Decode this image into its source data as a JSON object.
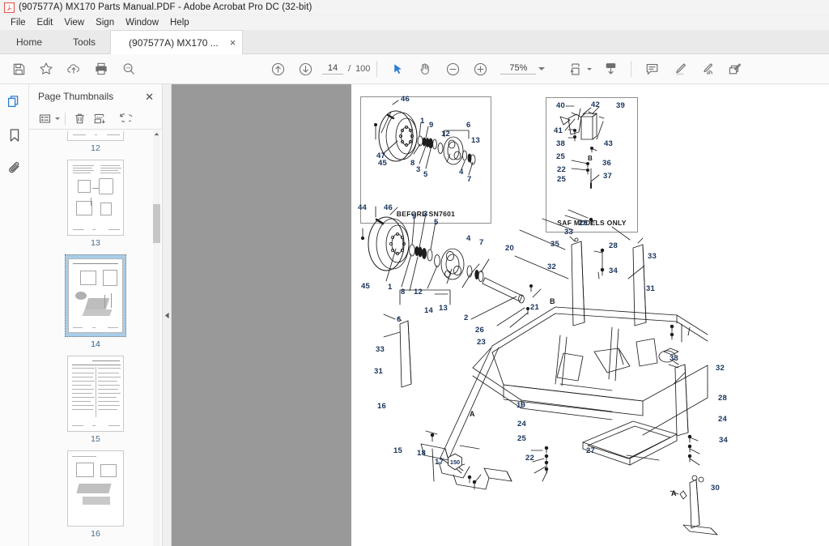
{
  "window": {
    "title": "(907577A) MX170 Parts Manual.PDF - Adobe Acrobat Pro DC (32-bit)",
    "app_icon": "acrobat-icon"
  },
  "menubar": {
    "items": [
      {
        "label": "File"
      },
      {
        "label": "Edit"
      },
      {
        "label": "View"
      },
      {
        "label": "Sign"
      },
      {
        "label": "Window"
      },
      {
        "label": "Help"
      }
    ]
  },
  "tabs": {
    "home_label": "Home",
    "tools_label": "Tools",
    "document_label": "(907577A) MX170 ...",
    "close_glyph": "×"
  },
  "toolbar": {
    "save_icon": "save-icon",
    "star_icon": "add-to-favorites-icon",
    "cloud_icon": "upload-to-cloud-icon",
    "print_icon": "print-icon",
    "search_icon": "search-icon",
    "prev_page_icon": "previous-page-icon",
    "next_page_icon": "next-page-icon",
    "page_current": "14",
    "page_separator": "/",
    "page_total": "100",
    "select_tool_icon": "select-cursor-icon",
    "hand_tool_icon": "hand-tool-icon",
    "zoom_out_icon": "zoom-out-icon",
    "zoom_in_icon": "zoom-in-icon",
    "zoom_value": "75%",
    "fit_page_icon": "fit-page-icon",
    "scroll_mode_icon": "page-display-icon",
    "comment_icon": "add-comment-icon",
    "highlight_icon": "highlight-text-icon",
    "draw_icon": "draw-freehand-icon",
    "stamp_icon": "add-stamp-icon"
  },
  "navrail": {
    "thumbnails_icon": "page-thumbnails-icon",
    "bookmarks_icon": "bookmarks-icon",
    "attachments_icon": "attachments-icon"
  },
  "thumbnail_panel": {
    "title": "Page Thumbnails",
    "close_glyph": "✕",
    "options_icon": "thumbnail-options-icon",
    "delete_icon": "delete-pages-icon",
    "extract_icon": "extract-pages-icon",
    "rotate_ccw_icon": "rotate-counterclockwise-icon",
    "rotate_cw_icon": "rotate-clockwise-icon",
    "pages": [
      {
        "number": "12",
        "selected": false,
        "kind": "clipped"
      },
      {
        "number": "13",
        "selected": false,
        "kind": "diagram"
      },
      {
        "number": "14",
        "selected": true,
        "kind": "diagram"
      },
      {
        "number": "15",
        "selected": false,
        "kind": "table"
      },
      {
        "number": "16",
        "selected": false,
        "kind": "diagram"
      }
    ]
  },
  "collapse_handle": {
    "icon": "collapse-left-arrow-icon"
  },
  "document": {
    "background_color": "#999999",
    "page_color": "#ffffff",
    "insets": [
      {
        "caption": "BEFORE SN7601"
      },
      {
        "caption": "SAF MODELS ONLY"
      }
    ],
    "inset1_callouts": [
      "46",
      "1",
      "9",
      "6",
      "47",
      "12",
      "13",
      "45",
      "8",
      "3",
      "5",
      "4",
      "7"
    ],
    "inset2_callouts": [
      "40",
      "42",
      "39",
      "41",
      "43",
      "38",
      "25",
      "B",
      "36",
      "22",
      "25",
      "37"
    ],
    "main_callouts": [
      "44",
      "46",
      "9",
      "3",
      "5",
      "4",
      "7",
      "20",
      "45",
      "1",
      "8",
      "12",
      "14",
      "13",
      "2",
      "26",
      "23",
      "6",
      "21",
      "B",
      "29",
      "33",
      "35",
      "28",
      "32",
      "34",
      "31",
      "33",
      "33",
      "31",
      "16",
      "A",
      "19",
      "24",
      "25",
      "15",
      "18",
      "17",
      "150",
      "22",
      "27",
      "32",
      "33",
      "28",
      "24",
      "34",
      "30",
      "A",
      "22",
      "25"
    ]
  }
}
